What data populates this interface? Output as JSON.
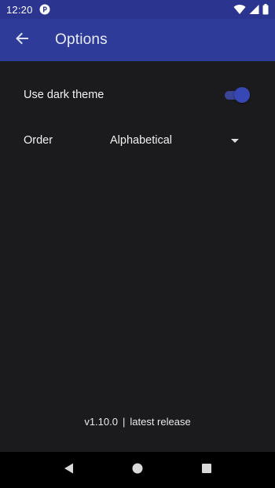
{
  "status_bar": {
    "time": "12:20",
    "notification_icon": "app-notification-icon",
    "icons": [
      "wifi-icon",
      "signal-icon",
      "battery-icon"
    ]
  },
  "app_bar": {
    "title": "Options",
    "back_icon": "arrow-back-icon",
    "background": "#2e3b98"
  },
  "settings": {
    "dark_theme": {
      "label": "Use dark theme",
      "enabled": true
    },
    "order": {
      "label": "Order",
      "selected": "Alphabetical"
    }
  },
  "footer": {
    "version": "v1.10.0",
    "separator": "|",
    "release_note": "latest release"
  },
  "nav_bar": {
    "buttons": [
      "back-triangle-icon",
      "home-circle-icon",
      "recents-square-icon"
    ]
  },
  "colors": {
    "accent": "#3748b4",
    "background": "#1b1b1d",
    "status_bar": "#2b3590"
  }
}
